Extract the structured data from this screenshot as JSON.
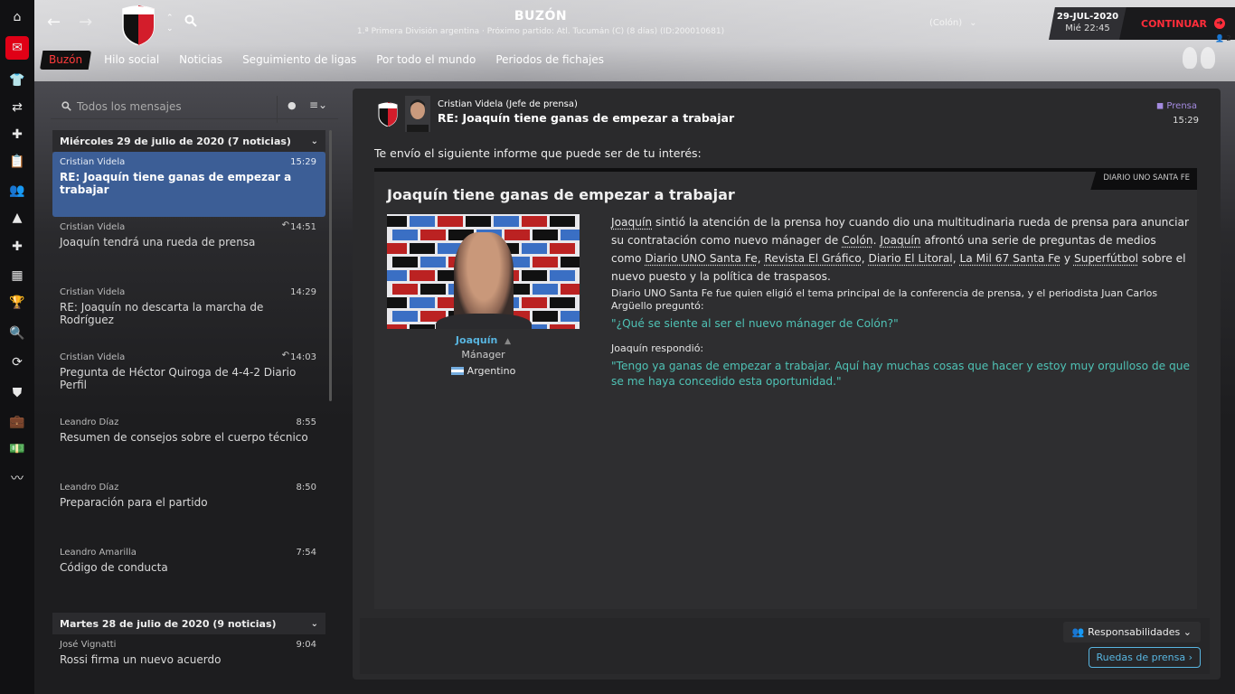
{
  "header": {
    "title": "BUZÓN",
    "subtitle": "1.ª Primera División argentina · Próximo partido: Atl. Tucumán (C) (8 días) (ID:200010681)",
    "club_selector": "(Colón)",
    "date": "29-JUL-2020",
    "day_time": "Mié 22:45",
    "continue_label": "CONTINUAR",
    "user_count": "2"
  },
  "tabs": [
    "Buzón",
    "Hilo social",
    "Noticias",
    "Seguimiento de ligas",
    "Por todo el mundo",
    "Periodos de fichajes"
  ],
  "sidebar_icons": [
    "home-icon",
    "inbox-icon",
    "squad-icon",
    "tactics-icon",
    "dynamics-icon",
    "reports-icon",
    "staff-icon",
    "training-icon",
    "medical-icon",
    "calendar-icon",
    "competitions-icon",
    "scouting-icon",
    "transfers-icon",
    "club-info-icon",
    "finances-icon",
    "dev-centre-icon",
    "stats-icon"
  ],
  "inbox": {
    "search_placeholder": "Todos los mensajes",
    "groups": [
      {
        "title": "Miércoles 29 de julio de 2020 (7 noticias)",
        "messages": [
          {
            "from": "Cristian Videla",
            "time": "15:29",
            "subject": "RE: Joaquín tiene ganas de empezar a trabajar",
            "selected": true,
            "replied": false
          },
          {
            "from": "Cristian Videla",
            "time": "14:51",
            "subject": "Joaquín tendrá una rueda de prensa",
            "replied": true
          },
          {
            "from": "Cristian Videla",
            "time": "14:29",
            "subject": "RE: Joaquín no descarta la marcha de Rodríguez",
            "replied": false
          },
          {
            "from": "Cristian Videla",
            "time": "14:03",
            "subject": "Pregunta de Héctor Quiroga de 4-4-2 Diario Perfil",
            "replied": true
          },
          {
            "from": "Leandro Díaz",
            "time": "8:55",
            "subject": "Resumen de consejos sobre el cuerpo técnico",
            "replied": false
          },
          {
            "from": "Leandro Díaz",
            "time": "8:50",
            "subject": "Preparación para el partido",
            "replied": false
          },
          {
            "from": "Leandro Amarilla",
            "time": "7:54",
            "subject": "Código de conducta",
            "replied": false
          }
        ]
      },
      {
        "title": "Martes 28 de julio de 2020 (9 noticias)",
        "messages": [
          {
            "from": "José Vignatti",
            "time": "9:04",
            "subject": "Rossi firma un nuevo acuerdo",
            "replied": false
          }
        ]
      }
    ]
  },
  "message": {
    "sender": "Cristian Videla  (Jefe de prensa)",
    "subject": "RE: Joaquín tiene ganas de empezar a trabajar",
    "tag": "Prensa",
    "time": "15:29",
    "intro": "Te envío el siguiente informe que puede ser de tu interés:",
    "article": {
      "source": "DIARIO UNO SANTA FE",
      "title": "Joaquín tiene ganas de empezar a trabajar",
      "person_name": "Joaquín",
      "person_role": "Mánager",
      "person_nationality": "Argentino",
      "para1_name": "Joaquín",
      "para1_a": " sintió la atención de la prensa hoy cuando dio una multitudinaria rueda de prensa para anunciar su contratación como nuevo mánager de ",
      "para1_club": "Colón",
      "para1_b": ". ",
      "para1_name2": "Joaquín",
      "para1_c": " afrontó una serie de preguntas de medios como ",
      "media1": "Diario UNO Santa Fe",
      "media_sep1": ", ",
      "media2": "Revista El Gráfico",
      "media_sep2": ", ",
      "media3": "Diario El Litoral",
      "media_sep3": ", ",
      "media4": "La Mil 67 Santa Fe",
      "media_sep4": " y ",
      "media5": "Superfútbol",
      "para1_d": " sobre el nuevo puesto y la política de traspasos.",
      "para2": "Diario UNO Santa Fe fue quien eligió el tema principal de la conferencia de prensa, y el periodista Juan Carlos Argüello preguntó:",
      "question": "\"¿Qué se siente al ser el nuevo mánager de Colón?\"",
      "response_intro": "Joaquín respondió:",
      "response": "\"Tengo ya ganas de empezar a trabajar. Aquí hay muchas cosas que hacer y estoy muy orgulloso de que se me haya concedido esta oportunidad.\""
    },
    "responsibilities_label": "Responsabilidades",
    "press_button_label": "Ruedas de prensa"
  },
  "colors": {
    "accent_red": "#e00016",
    "selected_blue": "#3c5e96",
    "link_blue": "#58b5e0",
    "quote_teal": "#4fc2b5",
    "press_purple": "#a48be0"
  }
}
